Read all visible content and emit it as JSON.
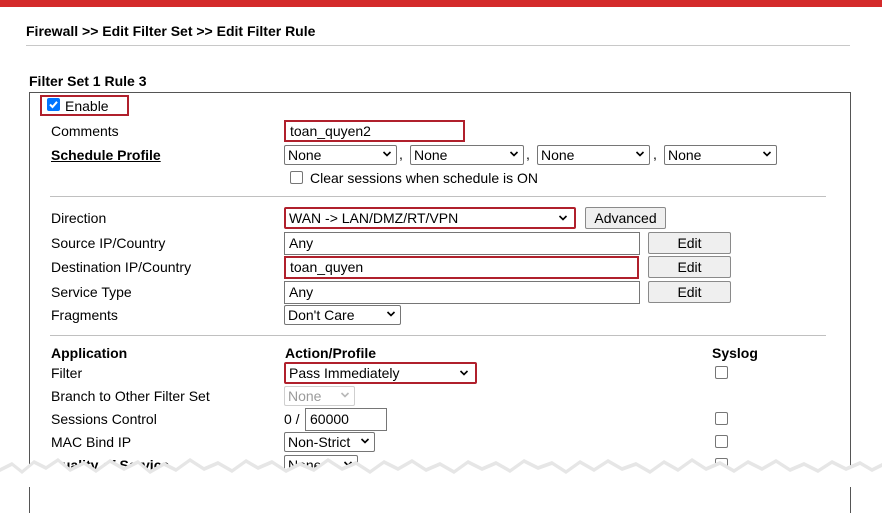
{
  "breadcrumb": "Firewall >> Edit Filter Set >> Edit Filter Rule",
  "rule_title": "Filter Set 1 Rule 3",
  "enable": {
    "label": "Enable",
    "checked": true
  },
  "comments": {
    "label": "Comments",
    "value": "toan_quyen2"
  },
  "schedule": {
    "label": "Schedule Profile",
    "profiles": [
      "None",
      "None",
      "None",
      "None"
    ],
    "separator": ",",
    "clear_sessions_label": "Clear sessions when schedule is ON"
  },
  "direction": {
    "label": "Direction",
    "value": "WAN -> LAN/DMZ/RT/VPN",
    "advanced_label": "Advanced"
  },
  "source": {
    "label": "Source IP/Country",
    "value": "Any",
    "edit_label": "Edit"
  },
  "destination": {
    "label": "Destination IP/Country",
    "value": "toan_quyen",
    "edit_label": "Edit"
  },
  "service": {
    "label": "Service Type",
    "value": "Any",
    "edit_label": "Edit"
  },
  "fragments": {
    "label": "Fragments",
    "value": "Don't Care"
  },
  "table_headers": {
    "application": "Application",
    "action": "Action/Profile",
    "syslog": "Syslog"
  },
  "filter": {
    "label": "Filter",
    "value": "Pass Immediately"
  },
  "branch": {
    "label": "Branch to Other Filter Set",
    "value": "None"
  },
  "sessions": {
    "label": "Sessions Control",
    "current": "0 /",
    "max": "60000"
  },
  "mac_bind": {
    "label": "MAC Bind IP",
    "value": "Non-Strict"
  },
  "qos": {
    "label": "Quality of Service",
    "value": "None"
  },
  "colors": {
    "accent_red": "#b0202c",
    "top_bar": "#d42a2a",
    "checkbox_blue": "#0075ff"
  }
}
